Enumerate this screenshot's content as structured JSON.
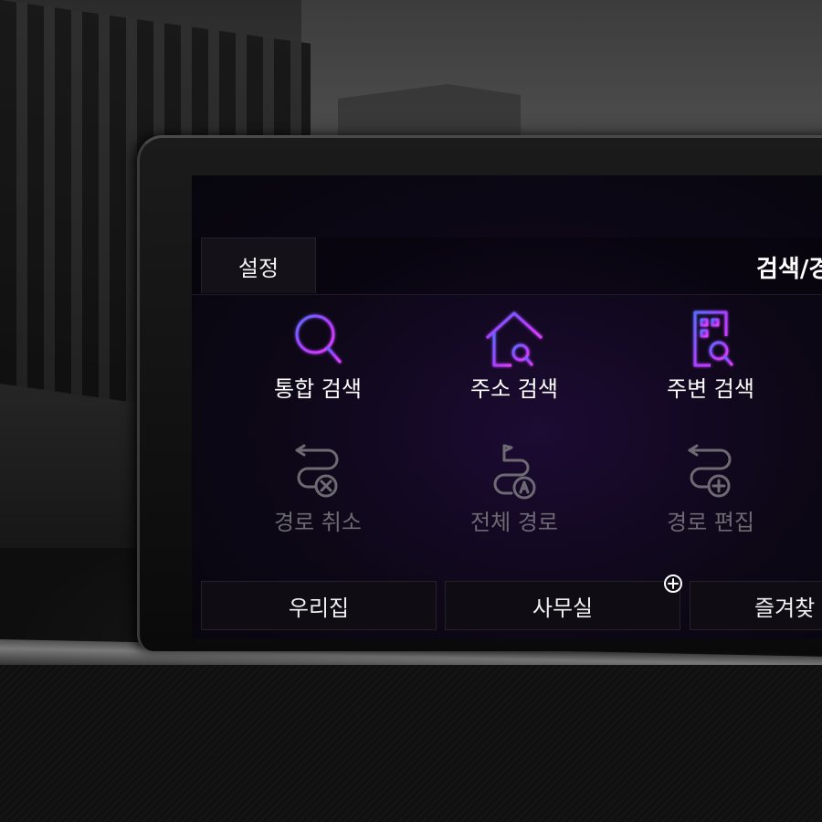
{
  "header": {
    "settings_tab": "설정",
    "title": "검색/경"
  },
  "search_tiles": [
    {
      "label": "통합 검색",
      "icon": "magnifier-icon"
    },
    {
      "label": "주소 검색",
      "icon": "house-search-icon"
    },
    {
      "label": "주변 검색",
      "icon": "building-search-icon"
    }
  ],
  "route_tiles": [
    {
      "label": "경로 취소",
      "icon": "route-cancel-icon",
      "enabled": false
    },
    {
      "label": "전체 경로",
      "icon": "route-overview-icon",
      "enabled": false
    },
    {
      "label": "경로 편집",
      "icon": "route-edit-icon",
      "enabled": false
    }
  ],
  "favorites": {
    "home": "우리집",
    "office": "사무실",
    "favorites": "즐겨찾",
    "add_icon": "plus-circle-icon"
  },
  "colors": {
    "accent_purple": "#b03cff",
    "accent_blue": "#5a6cff",
    "disabled": "#6d6a72"
  }
}
